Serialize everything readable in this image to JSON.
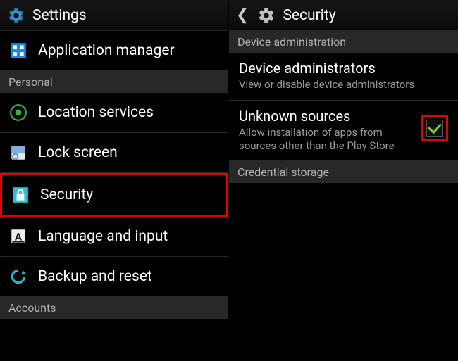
{
  "left": {
    "title": "Settings",
    "items": [
      {
        "label": "Application manager"
      },
      {
        "label": "Location services"
      },
      {
        "label": "Lock screen"
      },
      {
        "label": "Security"
      },
      {
        "label": "Language and input"
      },
      {
        "label": "Backup and reset"
      }
    ],
    "section_personal": "Personal",
    "section_accounts": "Accounts"
  },
  "right": {
    "title": "Security",
    "section_admin": "Device administration",
    "section_cred": "Credential storage",
    "items": [
      {
        "title": "Device administrators",
        "desc": "View or disable device administrators"
      },
      {
        "title": "Unknown sources",
        "desc": "Allow installation of apps from sources other than the Play Store"
      }
    ]
  }
}
